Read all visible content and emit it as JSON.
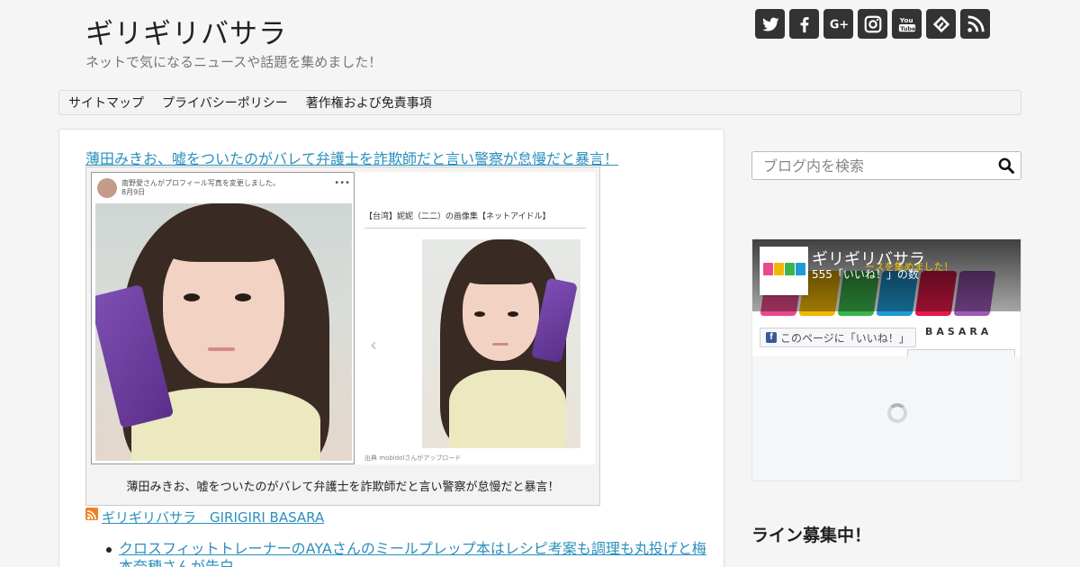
{
  "header": {
    "site_title": "ギリギリバサラ",
    "tagline": "ネットで気になるニュースや話題を集めました！",
    "social_icons": [
      "twitter-icon",
      "facebook-icon",
      "google-plus-icon",
      "instagram-icon",
      "youtube-icon",
      "feedly-icon",
      "rss-icon"
    ]
  },
  "nav": {
    "items": [
      {
        "label": "サイトマップ"
      },
      {
        "label": "プライバシーポリシー"
      },
      {
        "label": "著作権および免責事項"
      }
    ]
  },
  "article": {
    "title_link": "薄田みきお、嘘をついたのがバレて弁護士を詐欺師だと言い警察が怠慢だと暴言！",
    "photo": {
      "left_post_header": "南野愛さんがプロフィール写真を変更しました。",
      "left_post_date": "8月9日",
      "right_caption": "【台湾】妮妮（二二）の画像集【ネットアイドル】",
      "right_credit": "出典 mobidolさんがアップロード"
    },
    "caption": "薄田みきお、嘘をついたのがバレて弁護士を詐欺師だと言い警察が怠慢だと暴言！"
  },
  "feed": {
    "link": "ギリギリバサラ　GIRIGIRI BASARA",
    "items": [
      {
        "text": "クロスフィットトレーナーのAYAさんのミールプレップ本はレシピ考案も調理も丸投げと梅本奈穂さんが告白"
      }
    ]
  },
  "sidebar": {
    "search_placeholder": "ブログ内を検索",
    "fb": {
      "page_name": "ギリギリバサラ",
      "like_count": "555「いいね！」の数",
      "like_button": "このページに「いいね！」",
      "cover_basara": "BASARA",
      "cover_tag": "ースを集めました！"
    },
    "line_heading": "ライン募集中！"
  },
  "colors": {
    "link": "#2a8fbd",
    "social_bg": "#333333",
    "facebook": "#3b5998"
  }
}
